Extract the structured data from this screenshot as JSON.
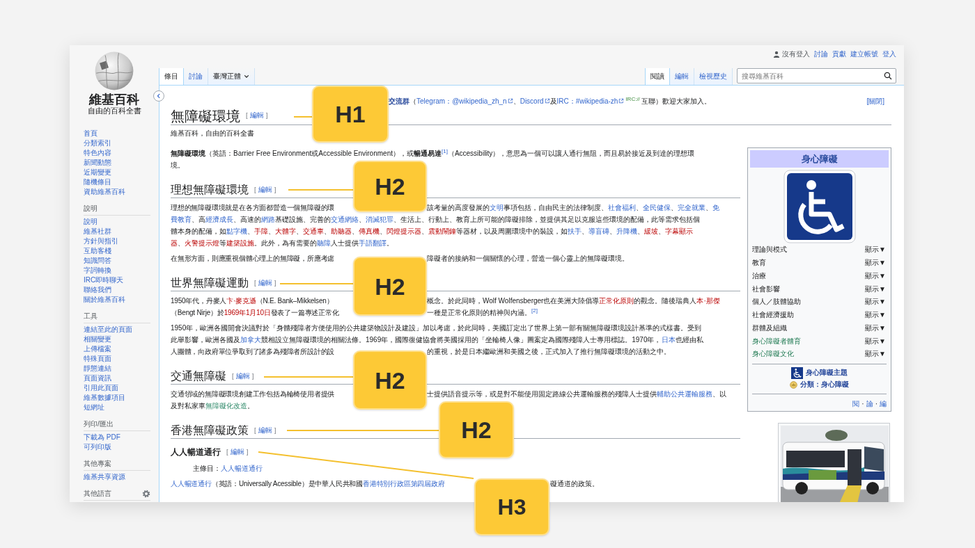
{
  "sidebar": {
    "logo_name": "維基百科",
    "logo_tagline": "自由的百科全書",
    "navigation": [
      "首頁",
      "分類索引",
      "特色內容",
      "新聞動態",
      "近期變更",
      "隨機條目",
      "資助維基百科"
    ],
    "portals": [
      {
        "heading": "說明",
        "items": [
          "說明",
          "維基社群",
          "方針與指引",
          "互助客棧",
          "知識問答",
          "字詞轉換",
          "IRC即時聊天",
          "聯絡我們",
          "關於維基百科"
        ]
      },
      {
        "heading": "工具",
        "items": [
          "連結至此的頁面",
          "相關變更",
          "上傳檔案",
          "特殊頁面",
          "靜態連結",
          "頁面資訊",
          "引用此頁面",
          "維基數據項目",
          "短網址"
        ]
      },
      {
        "heading": "列印/匯出",
        "items": [
          "下載為 PDF",
          "可列印版"
        ]
      },
      {
        "heading": "其他專案",
        "items": [
          "維基共享資源"
        ]
      },
      {
        "heading": "其他語言"
      }
    ]
  },
  "personal": {
    "status": "沒有登入",
    "links": [
      "討論",
      "貢獻",
      "建立帳號",
      "登入"
    ]
  },
  "tabs": {
    "left": [
      {
        "label": "條目",
        "selected": true
      },
      {
        "label": "討論",
        "selected": false
      }
    ],
    "variant": "臺灣正體",
    "right": [
      {
        "label": "閱讀",
        "selected": true
      },
      {
        "label": "編輯",
        "selected": false
      },
      {
        "label": "檢視歷史",
        "selected": false
      }
    ]
  },
  "search": {
    "placeholder": "搜尋維基百科"
  },
  "notice": {
    "callout": "H1",
    "close": "[關閉]",
    "runs": [
      {
        "kind": "boldlink",
        "text": "交流群"
      },
      {
        "kind": "plain",
        "text": "（"
      },
      {
        "kind": "extlink",
        "text": "Telegram：@wikipedia_zh_n"
      },
      {
        "kind": "plain",
        "text": "、"
      },
      {
        "kind": "extlink",
        "text": "Discord"
      },
      {
        "kind": "plain",
        "text": "及"
      },
      {
        "kind": "extlink",
        "text": "IRC：#wikipedia-zh"
      },
      {
        "kind": "irc",
        "text": "IRC://"
      },
      {
        "kind": "plain",
        "text": "互聯）歡迎大家加入。"
      }
    ]
  },
  "title": {
    "text": "無障礙環境",
    "edit": {
      "open": "[",
      "label": "編輯",
      "close": "]"
    }
  },
  "subtitle": "維基百科，自由的百科全書",
  "body": [
    {
      "kind": "paragraph",
      "lines": [
        {
          "runs": [
            {
              "kind": "bold",
              "text": "無障礙環境"
            },
            {
              "kind": "plain",
              "text": "（英語：Barrier Free Environment或Accessible Environment），或"
            },
            {
              "kind": "bold",
              "text": "暢通易達"
            },
            {
              "kind": "ref",
              "text": "[1]"
            },
            {
              "kind": "plain",
              "text": "（Accessibility），意思為一個可以讓人通行無阻，而且易於接近及到達的理想環"
            }
          ]
        },
        {
          "runs": [
            {
              "kind": "plain",
              "text": "境。"
            }
          ]
        }
      ]
    },
    {
      "kind": "heading2",
      "text": "理想無障礙環境",
      "edit": {
        "open": "[",
        "label": "編輯",
        "close": "]"
      }
    },
    {
      "kind": "paragraph",
      "lines": [
        {
          "callout": "H2",
          "pre": [
            {
              "kind": "plain",
              "text": "理想的無障礙環境就是在各方面都營造一個無障礙的環"
            }
          ],
          "post": [
            {
              "kind": "plain",
              "text": "該考量的高度發展的"
            },
            {
              "kind": "link",
              "text": "文明"
            },
            {
              "kind": "plain",
              "text": "事項包括，自由民主的法律制度、"
            },
            {
              "kind": "link",
              "text": "社會福利"
            },
            {
              "kind": "plain",
              "text": "、"
            },
            {
              "kind": "link",
              "text": "全民健保"
            },
            {
              "kind": "plain",
              "text": "、"
            },
            {
              "kind": "link",
              "text": "完全就業"
            },
            {
              "kind": "plain",
              "text": "、"
            },
            {
              "kind": "link",
              "text": "免"
            }
          ]
        },
        {
          "runs": [
            {
              "kind": "link",
              "text": "費教育"
            },
            {
              "kind": "plain",
              "text": "、高"
            },
            {
              "kind": "link",
              "text": "經濟成長"
            },
            {
              "kind": "plain",
              "text": "、高速的"
            },
            {
              "kind": "link",
              "text": "網路"
            },
            {
              "kind": "plain",
              "text": "基礎設施、完善的"
            },
            {
              "kind": "link",
              "text": "交通網絡"
            },
            {
              "kind": "plain",
              "text": "、"
            },
            {
              "kind": "link",
              "text": "消滅犯罪"
            },
            {
              "kind": "plain",
              "text": "、生活上、行動上、教育上所可能的障礙排除，並提供其足以克服這些環境的配備，此等需求包括個"
            }
          ]
        },
        {
          "runs": [
            {
              "kind": "plain",
              "text": "體本身的配備，如"
            },
            {
              "kind": "link",
              "text": "點字機"
            },
            {
              "kind": "plain",
              "text": "、"
            },
            {
              "kind": "red",
              "text": "手障"
            },
            {
              "kind": "plain",
              "text": "、"
            },
            {
              "kind": "red",
              "text": "大體字"
            },
            {
              "kind": "plain",
              "text": "、"
            },
            {
              "kind": "red",
              "text": "交通車"
            },
            {
              "kind": "plain",
              "text": "、"
            },
            {
              "kind": "red",
              "text": "助聽器"
            },
            {
              "kind": "plain",
              "text": "、"
            },
            {
              "kind": "red",
              "text": "傳真機"
            },
            {
              "kind": "plain",
              "text": "、"
            },
            {
              "kind": "red",
              "text": "閃燈提示器"
            },
            {
              "kind": "plain",
              "text": "、"
            },
            {
              "kind": "red",
              "text": "震動鬧鐘"
            },
            {
              "kind": "plain",
              "text": "等器材，以及周圍環境中的裝設，如"
            },
            {
              "kind": "link",
              "text": "扶手"
            },
            {
              "kind": "plain",
              "text": "、"
            },
            {
              "kind": "link",
              "text": "導盲磚"
            },
            {
              "kind": "plain",
              "text": "、"
            },
            {
              "kind": "link",
              "text": "升降機"
            },
            {
              "kind": "plain",
              "text": "、"
            },
            {
              "kind": "red",
              "text": "緩坡"
            },
            {
              "kind": "plain",
              "text": "、"
            },
            {
              "kind": "red",
              "text": "字幕顯示"
            }
          ]
        },
        {
          "runs": [
            {
              "kind": "red",
              "text": "器"
            },
            {
              "kind": "plain",
              "text": "、"
            },
            {
              "kind": "red",
              "text": "火警提示燈"
            },
            {
              "kind": "plain",
              "text": "等"
            },
            {
              "kind": "red",
              "text": "建築設施"
            },
            {
              "kind": "plain",
              "text": "。此外，為有需要的"
            },
            {
              "kind": "link",
              "text": "聽障"
            },
            {
              "kind": "plain",
              "text": "人士提供"
            },
            {
              "kind": "link",
              "text": "手語翻譯"
            },
            {
              "kind": "plain",
              "text": "。"
            }
          ]
        }
      ]
    },
    {
      "kind": "paragraph",
      "lines": [
        {
          "pre": [
            {
              "kind": "plain",
              "text": "在無形方面，則應重視個體心理上的無障礙，所應考慮"
            }
          ],
          "post": [
            {
              "kind": "plain",
              "text": "障礙者的接納和一個關懷的心理，營造一個心靈上的無障礙環境。"
            }
          ]
        }
      ]
    },
    {
      "kind": "heading2",
      "text": "世界無障礙運動",
      "edit": {
        "open": "[",
        "label": "編輯",
        "close": "]"
      }
    },
    {
      "kind": "paragraph",
      "lines": [
        {
          "callout": "H2",
          "pre": [
            {
              "kind": "plain",
              "text": "1950年代，丹麥人"
            },
            {
              "kind": "red",
              "text": "卞·麥克遜"
            },
            {
              "kind": "plain",
              "text": "（N.E. Bank–Mikkelsen）"
            }
          ],
          "post": [
            {
              "kind": "plain",
              "text": "概念。於此同時，Wolf Wolfensberger也在美洲大陸倡導"
            },
            {
              "kind": "red",
              "text": "正常化原則"
            },
            {
              "kind": "plain",
              "text": "的觀念。隨後瑞典人"
            },
            {
              "kind": "red",
              "text": "本·那傑"
            }
          ]
        },
        {
          "pre": [
            {
              "kind": "plain",
              "text": "（Bengt Nirje）於"
            },
            {
              "kind": "red",
              "text": "1969年1月10日"
            },
            {
              "kind": "plain",
              "text": "發表了一篇專述正常化"
            }
          ],
          "post": [
            {
              "kind": "plain",
              "text": "一種是正常化原則的精神與內涵。"
            },
            {
              "kind": "ref",
              "text": "[2]"
            }
          ]
        }
      ]
    },
    {
      "kind": "paragraph",
      "lines": [
        {
          "runs": [
            {
              "kind": "plain",
              "text": "1950年，歐洲各國開會決議對於「身體殘障者方便使用的公共建築物設計及建設」加以考慮，於此同時，美國訂定出了世界上第一部有關無障礙環境設計基準的式樣書。受到"
            }
          ]
        },
        {
          "runs": [
            {
              "kind": "plain",
              "text": "此舉影響，歐洲各國及"
            },
            {
              "kind": "link",
              "text": "加拿大"
            },
            {
              "kind": "plain",
              "text": "競相設立無障礙環境的相關法條。1969年，國際復健協會將美國採用的「坐輪椅人像」圖案定為國際殘障人士專用標誌。1970年，"
            },
            {
              "kind": "link",
              "text": "日本"
            },
            {
              "kind": "plain",
              "text": "也經由私"
            }
          ]
        },
        {
          "pre": [
            {
              "kind": "plain",
              "text": "人團體，向政府單位爭取到了諸多為殘障者所設計的設"
            }
          ],
          "post": [
            {
              "kind": "plain",
              "text": "的重視，於是日本繼歐洲和美國之後，正式加入了推行無障礙環境的活動之中。"
            }
          ]
        }
      ]
    },
    {
      "kind": "heading2",
      "text": "交通無障礙",
      "edit": {
        "open": "[",
        "label": "編輯",
        "close": "]"
      }
    },
    {
      "kind": "paragraph",
      "lines": [
        {
          "callout": "H2",
          "pre": [
            {
              "kind": "plain",
              "text": "交通領域的無障礙環境創建工作包括為輪椅使用者提供"
            }
          ],
          "post": [
            {
              "kind": "plain",
              "text": "士提供語音提示等，或是對不能使用固定路線公共運輸服務的殘障人士提供"
            },
            {
              "kind": "link",
              "text": "輔助公共運輸服務"
            },
            {
              "kind": "plain",
              "text": "、以"
            }
          ]
        },
        {
          "runs": [
            {
              "kind": "plain",
              "text": "及對私家車"
            },
            {
              "kind": "green",
              "text": "無障礙化改造"
            },
            {
              "kind": "plain",
              "text": "。"
            }
          ]
        }
      ]
    },
    {
      "kind": "heading2",
      "text": "香港無障礙政策",
      "edit": {
        "open": "[",
        "label": "編輯",
        "close": "]"
      },
      "callout": "H2"
    },
    {
      "kind": "heading3",
      "text": "人人暢道通行",
      "edit": {
        "open": "[",
        "label": "編輯",
        "close": "]"
      }
    },
    {
      "kind": "hatnote",
      "label": "主條目：",
      "link": "人人暢道通行"
    },
    {
      "kind": "paragraph",
      "lines": [
        {
          "callout": "H3",
          "pre": [
            {
              "kind": "link",
              "text": "人人暢道通行"
            },
            {
              "kind": "plain",
              "text": "（英語：Universally Acessible）是中華人民共和國"
            },
            {
              "kind": "link",
              "text": "香港特別行政區第四屆政府"
            }
          ],
          "post": [
            {
              "kind": "plain",
              "text": "礙通道的政策。"
            }
          ]
        }
      ]
    }
  ],
  "infobox": {
    "title": "身心障礙",
    "rows": [
      {
        "label": "理論與模式",
        "toggle": "顯示▼",
        "linked": false
      },
      {
        "label": "教育",
        "toggle": "顯示▼",
        "linked": false
      },
      {
        "label": "治療",
        "toggle": "顯示▼",
        "linked": false
      },
      {
        "label": "社會影響",
        "toggle": "顯示▼",
        "linked": false
      },
      {
        "label": "個人／肢體協助",
        "toggle": "顯示▼",
        "linked": false
      },
      {
        "label": "社會經濟援助",
        "toggle": "顯示▼",
        "linked": false
      },
      {
        "label": "群體及組織",
        "toggle": "顯示▼",
        "linked": false
      },
      {
        "label": "身心障礙者體育",
        "toggle": "顯示▼",
        "linked": true
      },
      {
        "label": "身心障礙文化",
        "toggle": "顯示▼",
        "linked": true
      }
    ],
    "portal": "身心障礙主題",
    "category": "分類：身心障礙",
    "navbar": [
      {
        "kind": "link",
        "text": "閱"
      },
      {
        "kind": "separator",
        "text": "·"
      },
      {
        "kind": "link",
        "text": "論"
      },
      {
        "kind": "separator",
        "text": "·"
      },
      {
        "kind": "link",
        "text": "編"
      }
    ]
  }
}
